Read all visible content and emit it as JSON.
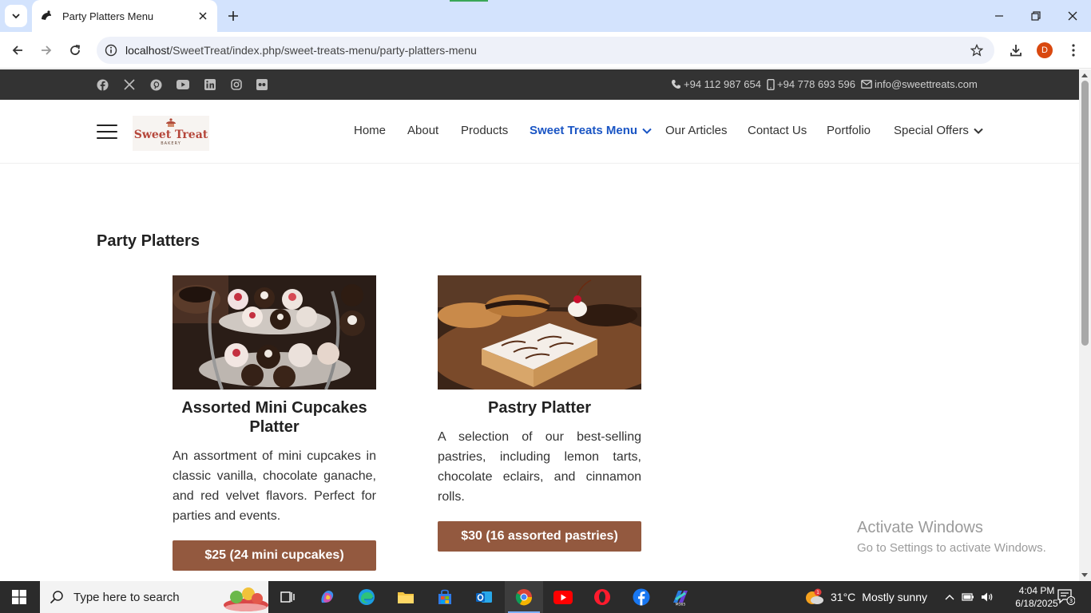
{
  "browser": {
    "tab_title": "Party Platters Menu",
    "url_host": "localhost",
    "url_path": "/SweetTreat/index.php/sweet-treats-menu/party-platters-menu",
    "profile_initial": "D"
  },
  "topbar": {
    "socials": [
      "facebook-icon",
      "x-icon",
      "pinterest-icon",
      "youtube-icon",
      "linkedin-icon",
      "instagram-icon",
      "flickr-icon"
    ],
    "phone": "+94 112 987 654",
    "mobile": "+94 778 693 596",
    "email": "info@sweettreats.com"
  },
  "header": {
    "logo_text": "Sweet Treat",
    "logo_sub": "BAKERY",
    "nav": [
      {
        "label": "Home"
      },
      {
        "label": "About"
      },
      {
        "label": "Products"
      },
      {
        "label": "Sweet Treats Menu",
        "active": true,
        "dropdown": true
      },
      {
        "label": "Our Articles"
      },
      {
        "label": "Contact Us"
      },
      {
        "label": "Portfolio"
      },
      {
        "label": "Special Offers",
        "dropdown": true
      }
    ]
  },
  "main": {
    "section_title": "Party Platters",
    "cards": [
      {
        "name": "Assorted Mini Cupcakes Platter",
        "description": "An assortment of mini cupcakes in classic vanilla, chocolate ganache, and red velvet flavors. Perfect for parties and events.",
        "price": "$25 (24 mini cupcakes)"
      },
      {
        "name": "Pastry Platter",
        "description": "A selection of our best-selling pastries, including lemon tarts, chocolate eclairs, and cinnamon rolls.",
        "price": "$30 (16 assorted pastries)"
      }
    ]
  },
  "watermark": {
    "line1": "Activate Windows",
    "line2": "Go to Settings to activate Windows."
  },
  "taskbar": {
    "search_placeholder": "Type here to search",
    "weather_temp": "31°C",
    "weather_text": "Mostly sunny",
    "weather_badge": "1",
    "time": "4:04 PM",
    "date": "6/18/2025",
    "notification_count": "3"
  },
  "colors": {
    "accent_nav": "#1a55c4",
    "price_button": "#93593f",
    "topbar": "#333333",
    "chrome_tabbar": "#d3e3fd"
  }
}
